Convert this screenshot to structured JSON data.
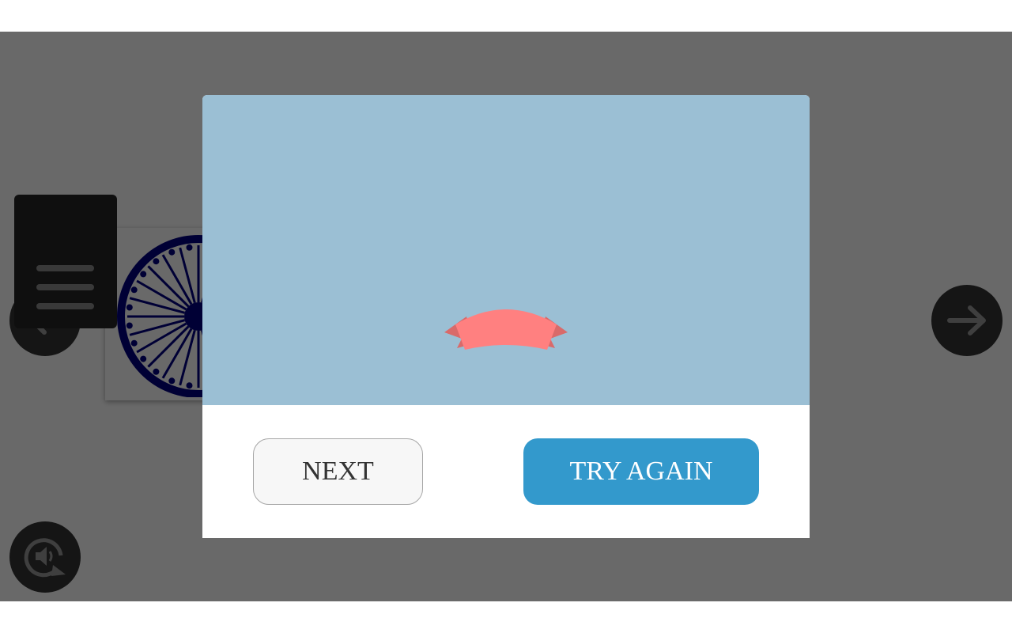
{
  "modal": {
    "next_label": "NEXT",
    "try_again_label": "TRY AGAIN"
  },
  "icons": {
    "prev": "arrow-left-icon",
    "next": "arrow-right-icon",
    "menu": "hamburger-menu-icon",
    "audio": "replay-audio-icon",
    "ribbon": "ribbon-banner-icon",
    "wheel": "ashoka-chakra-icon"
  },
  "colors": {
    "overlay": "#686868",
    "modal_art_background": "#9bbfd4",
    "ribbon": "#ff8080",
    "ribbon_fold": "#d96a6a",
    "try_again": "#3399cc",
    "next_button": "#f7f7f7",
    "wheel": "#000080"
  }
}
